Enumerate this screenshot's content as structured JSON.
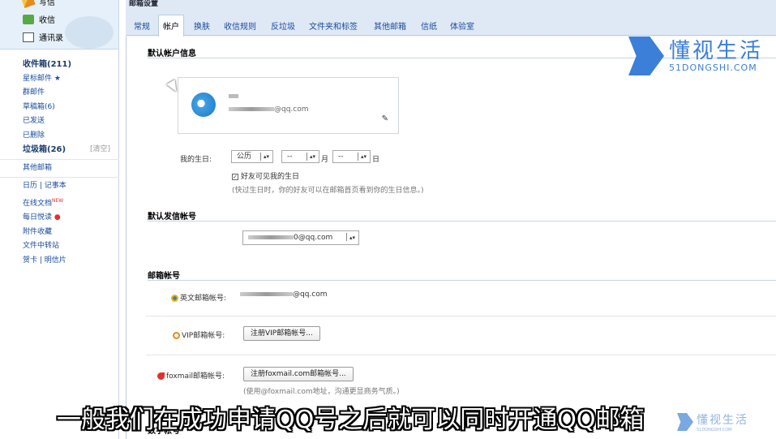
{
  "sidebar": {
    "write": "写信",
    "inbox": "收信",
    "contacts": "通讯录",
    "folders": [
      {
        "label": "收件箱(211)",
        "bold": true
      },
      {
        "label": "星标邮件 ★"
      },
      {
        "label": "群邮件"
      },
      {
        "label": "草稿箱(6)"
      },
      {
        "label": "已发送"
      },
      {
        "label": "已删除"
      }
    ],
    "spam": {
      "label": "垃圾箱(26)",
      "action": "[清空]"
    },
    "other": "其他邮箱",
    "tools": {
      "calendar": "日历",
      "notes": "记事本",
      "docs": "在线文档",
      "docs_badge": "NEW",
      "daily": "每日悦读",
      "attachments": "附件收藏",
      "transfer": "文件中转站",
      "cards": "贺卡",
      "postcards": "明信片"
    }
  },
  "main": {
    "title": "邮箱设置",
    "tabs": [
      "常规",
      "帐户",
      "换肤",
      "收信规则",
      "反垃圾",
      "文件夹和标签",
      "其他邮箱",
      "信纸",
      "体验室"
    ],
    "active_tab": "帐户"
  },
  "account": {
    "section_default_info": "默认帐户信息",
    "email_suffix": "@qq.com",
    "birthday_label": "我的生日:",
    "calendar_type": "公历",
    "month_value": "--",
    "month_unit": "月",
    "day_value": "--",
    "day_unit": "日",
    "friends_see_birthday": "好友可见我的生日",
    "birthday_hint": "(快过生日时，你的好友可以在邮箱首页看到你的生日信息。)",
    "section_default_sender": "默认发信帐号",
    "sender_value": "0@qq.com",
    "section_mail_accounts": "邮箱帐号",
    "english_account_label": "英文邮箱帐号:",
    "english_account_value": "@qq.com",
    "vip_account_label": "VIP邮箱帐号:",
    "vip_register_button": "注册VIP邮箱帐号...",
    "foxmail_label": "foxmail邮箱帐号:",
    "foxmail_register_button": "注册foxmail.com邮箱帐号...",
    "foxmail_hint": "(使用@foxmail.com地址，沟通更显商务气质。)",
    "section_digit_account": "数字帐号"
  },
  "watermark": {
    "brand": "懂视生活",
    "domain": "51DONGSHI.COM"
  },
  "caption": "一般我们在成功申请QQ号之后就可以同时开通QQ邮箱"
}
